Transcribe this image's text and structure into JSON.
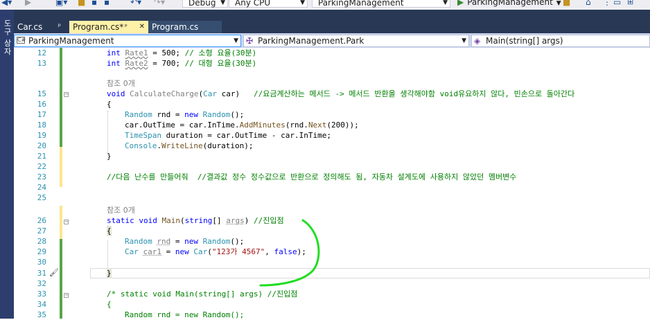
{
  "toolbar": {
    "config": "Debug",
    "platform": "Any CPU",
    "project": "ParkingManagement",
    "run_label": "ParkingManagement"
  },
  "side_panel": {
    "label": "도구 상자"
  },
  "tabs": [
    {
      "label": "Car.cs"
    },
    {
      "label": "Program.cs*"
    },
    {
      "label": "Program.cs"
    }
  ],
  "navbar": {
    "project": "ParkingManagement",
    "type": "ParkingManagement.Park",
    "member": "Main(string[] args)"
  },
  "code": {
    "l12a": "int ",
    "l12b": "Rate1",
    "l12c": " = 500; ",
    "l12d": "// 소형 요율(30분)",
    "l13a": "int ",
    "l13b": "Rate2",
    "l13c": " = 700; ",
    "l13d": "// 대형 요율(30분)",
    "ref1": "참조 0개",
    "l15a": "void ",
    "l15b": "CalculateCharge",
    "l15c": "(",
    "l15d": "Car",
    "l15e": " car)   ",
    "l15f": "//요금계산하는 메서드 -> 메서드 반환을 생각해야함 void유요하지 않다, 빈손으로 돌아간다",
    "l16": "{",
    "l17a": "Random",
    "l17b": " rnd = ",
    "l17c": "new ",
    "l17d": "Random",
    "l17e": "();",
    "l18a": "car.OutTime = car.InTime.",
    "l18b": "AddMinutes",
    "l18c": "(rnd.",
    "l18d": "Next",
    "l18e": "(200));",
    "l19a": "TimeSpan",
    "l19b": " duration = car.OutTime - car.InTime;",
    "l20a": "Console",
    "l20b": ".",
    "l20c": "WriteLine",
    "l20d": "(duration);",
    "l21": "}",
    "l23": "//다음 난수를 만들어줘  //결과값 정수 정수값으로 반환으로 정의해도 됨, 자동차 설계도에 사용하지 않았던 멤버변수",
    "ref2": "참조 0개",
    "l26a": "static ",
    "l26b": "void ",
    "l26c": "Main",
    "l26d": "(",
    "l26e": "string",
    "l26f": "[] ",
    "l26g": "args",
    "l26h": ") ",
    "l26i": "//진입점",
    "l27": "{",
    "l28a": "Random",
    "l28b": " ",
    "l28c": "rnd",
    "l28d": " = ",
    "l28e": "new ",
    "l28f": "Random",
    "l28g": "();",
    "l29a": "Car",
    "l29b": " ",
    "l29c": "car1",
    "l29d": " = ",
    "l29e": "new ",
    "l29f": "Car",
    "l29g": "(",
    "l29h": "\"123가 4567\"",
    "l29i": ", ",
    "l29j": "false",
    "l29k": ");",
    "l31": "}",
    "l33": "/* static void Main(string[] args) //진입점",
    "l34": "{",
    "l35": "Random rnd = new Random();"
  },
  "line_numbers": [
    "12",
    "13",
    "15",
    "16",
    "17",
    "18",
    "19",
    "20",
    "21",
    "22",
    "23",
    "24",
    "25",
    "26",
    "27",
    "28",
    "29",
    "30",
    "31",
    "32",
    "33",
    "34",
    "35"
  ],
  "colors": {
    "keyword": "#0000ff",
    "type": "#2b91af",
    "comment": "#008000",
    "string": "#a31515",
    "method": "#74531f",
    "tab_bar": "#293955",
    "active_tab": "#fff1a8",
    "annotation": "#22dd22"
  }
}
